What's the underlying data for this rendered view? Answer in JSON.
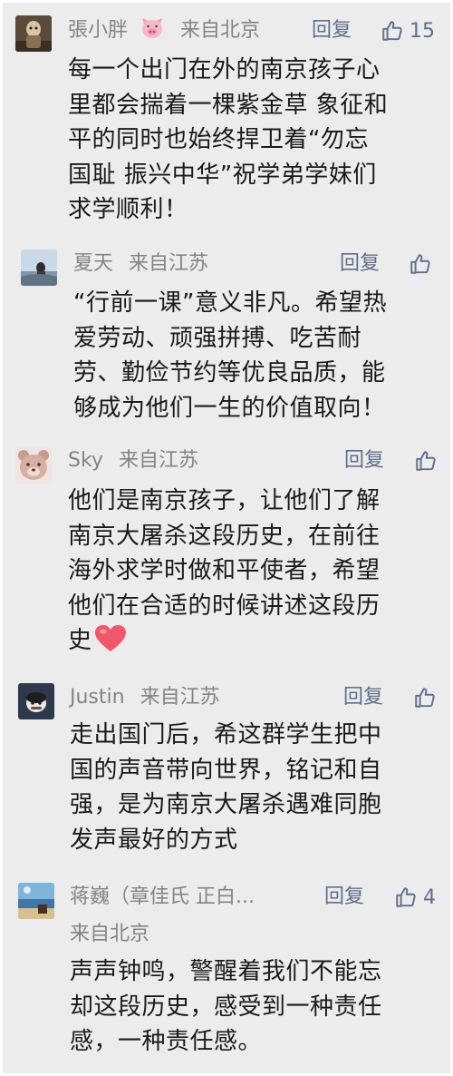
{
  "comments": [
    {
      "name": "張小胖",
      "location": "来自北京",
      "reply_label": "回复",
      "likes": "15",
      "avatar_icon": "figure-photo",
      "lines": [
        "每一个出门在外的南京孩子心",
        "里都会揣着一棵紫金草 象征和",
        "平的同时也始终捍卫着“勿忘",
        "国耻 振兴中华”祝学弟学妹们",
        "求学顺利！"
      ]
    },
    {
      "name": "夏天",
      "location": "来自江苏",
      "reply_label": "回复",
      "likes": "",
      "avatar_icon": "landscape-photo",
      "lines": [
        "“行前一课”意义非凡。希望热",
        "爱劳动、顽强拼搏、吃苦耐",
        "劳、勤俭节约等优良品质，能",
        "够成为他们一生的价值取向！"
      ]
    },
    {
      "name": "Sky",
      "location": "来自江苏",
      "reply_label": "回复",
      "likes": "",
      "avatar_icon": "bear-face",
      "lines": [
        "他们是南京孩子，让他们了解",
        "南京大屠杀这段历史，在前往",
        "海外求学时做和平使者，希望",
        "他们在合适的时候讲述这段历",
        "史"
      ]
    },
    {
      "name": "Justin",
      "location": "来自江苏",
      "reply_label": "回复",
      "likes": "",
      "avatar_icon": "dark-cartoon",
      "lines": [
        "走出国门后，希这群学生把中",
        "国的声音带向世界，铭记和自",
        "强，是为南京大屠杀遇难同胞",
        "发声最好的方式"
      ]
    },
    {
      "name": "蒋巍（章佳氏 正白...",
      "location": "来自北京",
      "reply_label": "回复",
      "likes": "4",
      "avatar_icon": "seaside-photo",
      "lines": [
        "声声钟鸣，警醒着我们不能忘",
        "却这段历史，感受到一种责任",
        "感，一种责任感。"
      ]
    }
  ],
  "colors": {
    "background": "#ececec",
    "name": "#848484",
    "action": "#5f6f8d",
    "text": "#1a1a1a",
    "heart": "#f0586a"
  },
  "icons": [
    "thumbs-up-icon",
    "heart-emoji-icon",
    "pig-emoji-icon"
  ]
}
